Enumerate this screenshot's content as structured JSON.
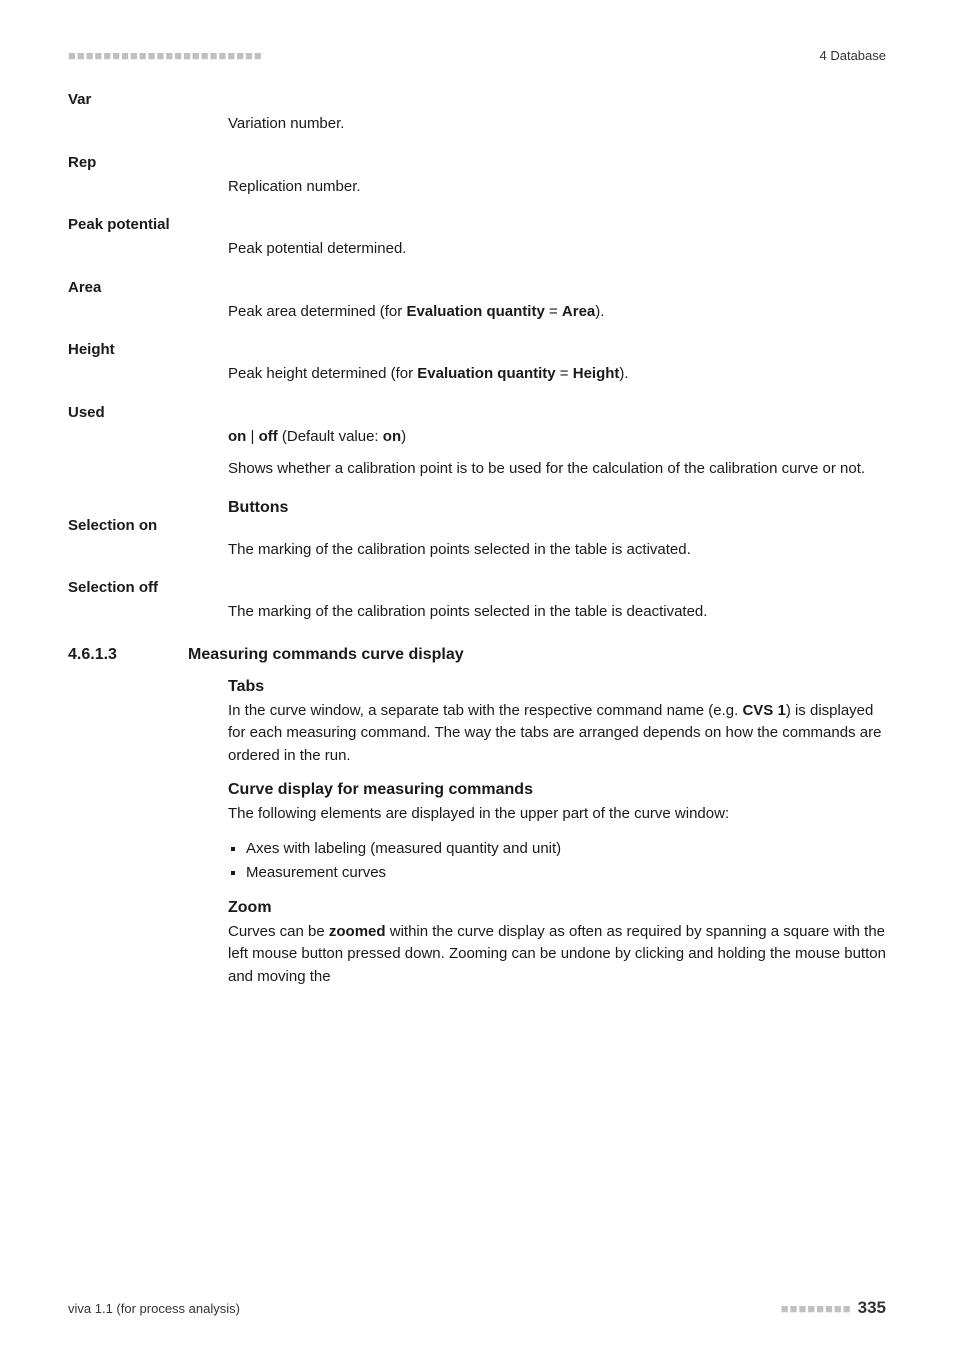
{
  "header": {
    "dashes": "■■■■■■■■■■■■■■■■■■■■■■",
    "section": "4 Database"
  },
  "defs": {
    "var": {
      "term": "Var",
      "desc": "Variation number."
    },
    "rep": {
      "term": "Rep",
      "desc": "Replication number."
    },
    "peakp": {
      "term": "Peak potential",
      "desc": "Peak potential determined."
    },
    "area": {
      "term": "Area",
      "desc_pre": "Peak area determined (for ",
      "bold1": "Evaluation quantity",
      "mid": " = ",
      "bold2": "Area",
      "desc_post": ")."
    },
    "height": {
      "term": "Height",
      "desc_pre": "Peak height determined (for ",
      "bold1": "Evaluation quantity",
      "mid": " = ",
      "bold2": "Height",
      "desc_post": ")."
    },
    "used": {
      "term": "Used",
      "line1_b1": "on",
      "line1_sep": " | ",
      "line1_b2": "off",
      "line1_mid": " (Default value: ",
      "line1_b3": "on",
      "line1_end": ")",
      "line2": "Shows whether a calibration point is to be used for the calculation of the calibration curve or not."
    }
  },
  "buttons": {
    "heading": "Buttons",
    "sel_on": {
      "term": "Selection on",
      "desc": "The marking of the calibration points selected in the table is activated."
    },
    "sel_off": {
      "term": "Selection off",
      "desc": "The marking of the calibration points selected in the table is deactivated."
    }
  },
  "section": {
    "num": "4.6.1.3",
    "title": "Measuring commands curve display",
    "tabs_h": "Tabs",
    "tabs_p_pre": "In the curve window, a separate tab with the respective command name (e.g. ",
    "tabs_p_bold": "CVS 1",
    "tabs_p_post": ") is displayed for each measuring command. The way the tabs are arranged depends on how the commands are ordered in the run.",
    "curve_h": "Curve display for measuring commands",
    "curve_p": "The following elements are displayed in the upper part of the curve window:",
    "bullets": [
      "Axes with labeling (measured quantity and unit)",
      "Measurement curves"
    ],
    "zoom_h": "Zoom",
    "zoom_p_pre": "Curves can be ",
    "zoom_p_bold": "zoomed",
    "zoom_p_post": " within the curve display as often as required by spanning a square with the left mouse button pressed down. Zooming can be undone by clicking and holding the mouse button and moving the"
  },
  "footer": {
    "left": "viva 1.1 (for process analysis)",
    "dashes": "■■■■■■■■",
    "page": "335"
  }
}
